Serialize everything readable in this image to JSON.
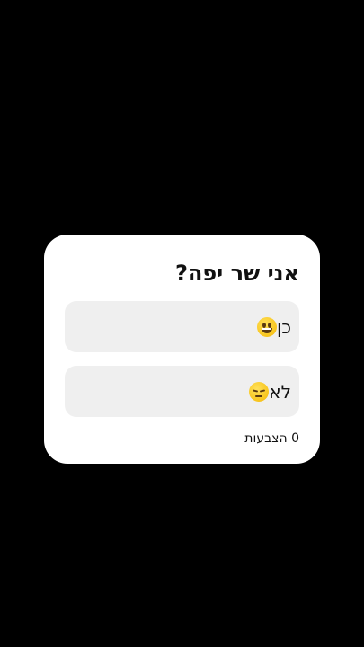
{
  "poll": {
    "question": "אני שר יפה?",
    "options": [
      {
        "label": "כן",
        "icon": "grinning-face-emoji"
      },
      {
        "label": "לא",
        "icon": "pensive-face-emoji"
      }
    ],
    "votes_text": "0 הצבעות"
  },
  "colors": {
    "background": "#000000",
    "card": "#ffffff",
    "option_bg": "#efefef",
    "text": "#111111"
  }
}
